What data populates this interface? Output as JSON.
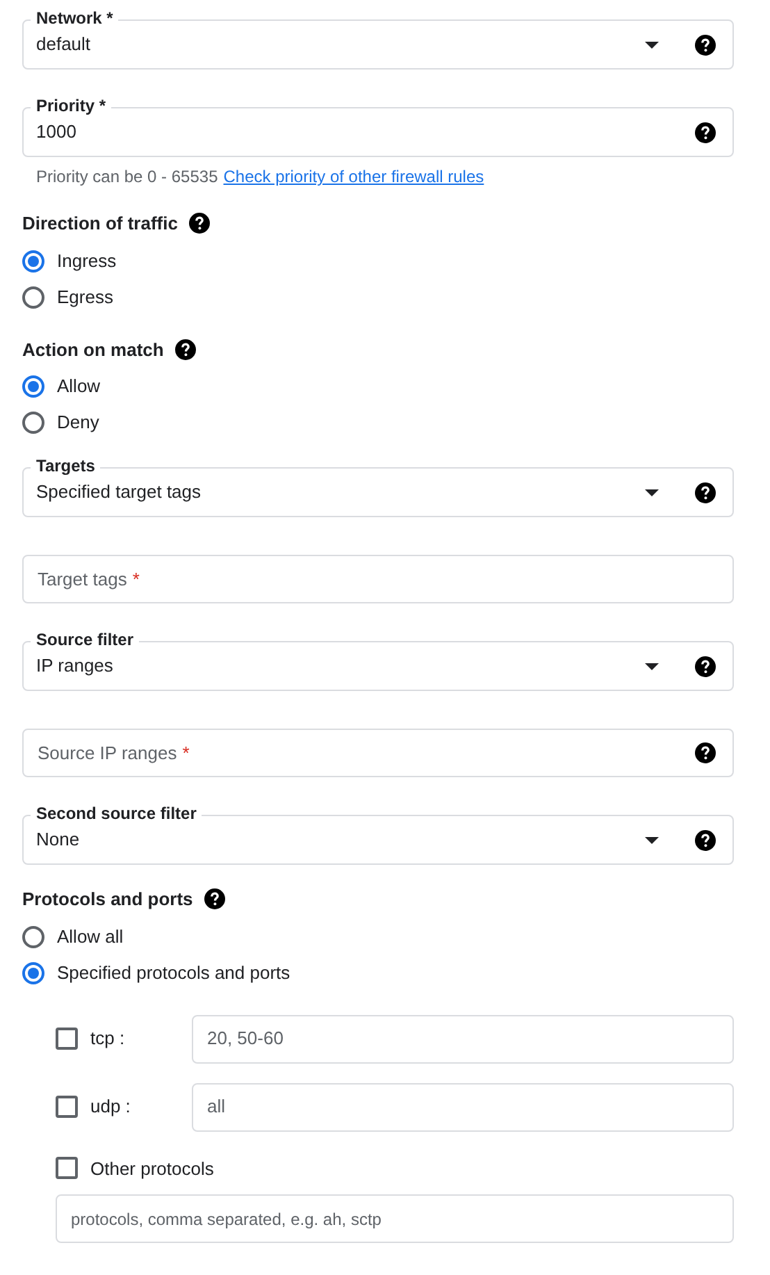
{
  "items": [
    {
      "kind": "select",
      "label": "Network *",
      "value": "default",
      "help": true
    },
    {
      "kind": "text",
      "label": "Priority *",
      "value": "1000",
      "help": true,
      "hint": "Priority can be 0 - 65535",
      "link": "Check priority of other firewall rules"
    },
    {
      "kind": "radios",
      "heading": "Direction of traffic",
      "help": true,
      "options": [
        {
          "label": "Ingress",
          "selected": true
        },
        {
          "label": "Egress",
          "selected": false
        }
      ]
    },
    {
      "kind": "radios",
      "heading": "Action on match",
      "help": true,
      "options": [
        {
          "label": "Allow",
          "selected": true
        },
        {
          "label": "Deny",
          "selected": false
        }
      ]
    },
    {
      "kind": "select",
      "label": "Targets",
      "value": "Specified target tags",
      "help": true
    },
    {
      "kind": "input",
      "placeholder": "Target tags",
      "required_mark": "*",
      "help": false
    },
    {
      "kind": "select",
      "label": "Source filter",
      "value": "IP ranges",
      "help": true
    },
    {
      "kind": "input",
      "placeholder": "Source IP ranges",
      "required_mark": "*",
      "help": true
    },
    {
      "kind": "select",
      "label": "Second source filter",
      "value": "None",
      "help": true
    },
    {
      "kind": "radios",
      "heading": "Protocols and ports",
      "help": true,
      "options": [
        {
          "label": "Allow all",
          "selected": false
        },
        {
          "label": "Specified protocols and ports",
          "selected": true
        }
      ]
    },
    {
      "kind": "ports",
      "rows": [
        {
          "label": "tcp :",
          "checked": false,
          "placeholder": "20, 50-60"
        },
        {
          "label": "udp :",
          "checked": false,
          "placeholder": "all"
        }
      ],
      "other": {
        "label": "Other protocols",
        "checked": false,
        "placeholder": "protocols, comma separated, e.g. ah, sctp"
      }
    }
  ]
}
